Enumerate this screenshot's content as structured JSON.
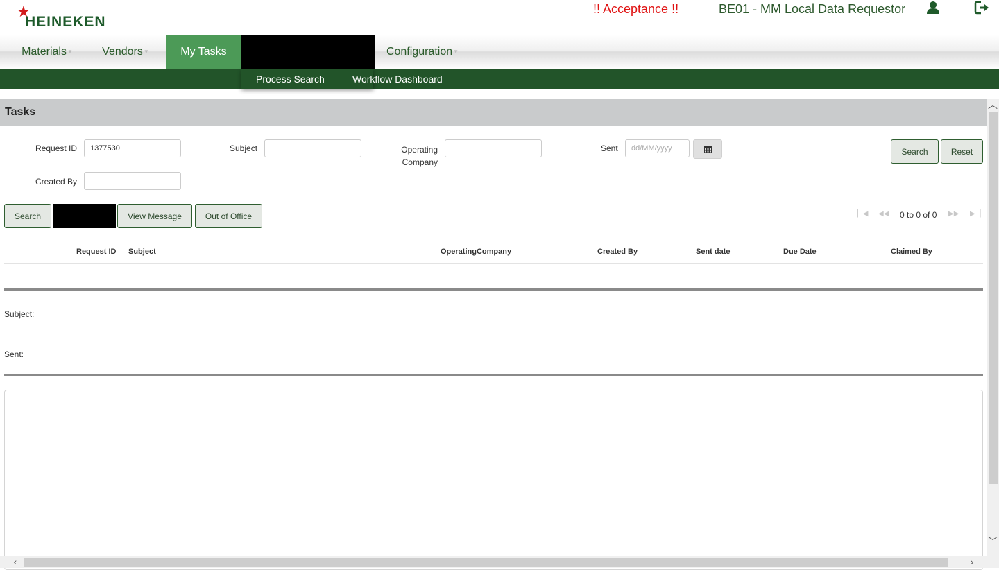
{
  "header": {
    "brand": "HEINEKEN",
    "environment": "!! Acceptance !!",
    "role": "BE01 - MM Local Data Requestor",
    "user_icon": "user-icon",
    "logout_icon": "logout-icon"
  },
  "nav": {
    "items": [
      {
        "label": "Materials"
      },
      {
        "label": "Vendors"
      },
      {
        "label": "My Tasks"
      },
      {
        "label": ""
      },
      {
        "label": "Configuration"
      }
    ],
    "submenu": [
      {
        "label": "Process Search"
      },
      {
        "label": "Workflow Dashboard"
      }
    ],
    "colors": {
      "accent": "#4c9a57",
      "bar": "#225429"
    }
  },
  "tasks": {
    "title": "Tasks",
    "filters": {
      "request_id": {
        "label": "Request ID",
        "value": "1377530"
      },
      "subject": {
        "label": "Subject",
        "value": ""
      },
      "operating_company": {
        "label_line1": "Operating",
        "label_line2": "Company",
        "value": ""
      },
      "sent": {
        "label": "Sent",
        "value": "",
        "placeholder": "dd/MM/yyyy"
      },
      "created_by": {
        "label": "Created By",
        "value": ""
      }
    },
    "buttons": {
      "search": "Search",
      "reset": "Reset",
      "search2": "Search",
      "view_message": "View Message",
      "out_of_office": "Out of Office"
    },
    "pager": {
      "text": "0 to 0 of 0"
    },
    "table": {
      "columns": [
        "Request ID",
        "Subject",
        "OperatingCompany",
        "Created By",
        "Sent date",
        "Due Date",
        "Claimed By"
      ],
      "rows": []
    },
    "detail": {
      "subject_label": "Subject:",
      "sent_label": "Sent:"
    }
  }
}
